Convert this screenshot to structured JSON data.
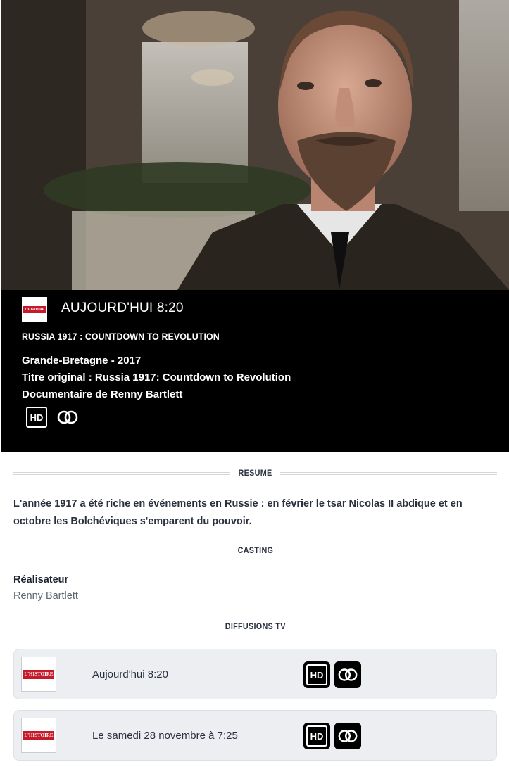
{
  "program": {
    "channel_logo_text": "L'HISTOIRE",
    "airing": "AUJOURD'HUI 8:20",
    "title": "RUSSIA 1917 : COUNTDOWN TO REVOLUTION",
    "country_year": "Grande-Bretagne - 2017",
    "original_title": "Titre original : Russia 1917: Countdown to Revolution",
    "genre_director": "Documentaire de Renny Bartlett",
    "badges": [
      {
        "icon": "hd-icon",
        "label": "HD"
      },
      {
        "icon": "vm-icon"
      }
    ]
  },
  "sections": {
    "resume": "RÉSUMÉ",
    "casting": "CASTING",
    "diffusions": "DIFFUSIONS TV"
  },
  "summary": "L'année 1917 a été riche en événements en Russie : en février le tsar Nicolas II abdique et en octobre les Bolchéviques s'emparent du pouvoir.",
  "casting": {
    "role": "Réalisateur",
    "name": "Renny Bartlett"
  },
  "broadcasts": [
    {
      "channel_logo_text": "L'HISTOIRE",
      "when": "Aujourd'hui 8:20",
      "hd_label": "HD"
    },
    {
      "channel_logo_text": "L'HISTOIRE",
      "when": "Le samedi 28 novembre à 7:25",
      "hd_label": "HD"
    }
  ],
  "colors": {
    "panel": "#000000",
    "accent_red": "#c41a2a",
    "row_background": "#eceef1"
  }
}
